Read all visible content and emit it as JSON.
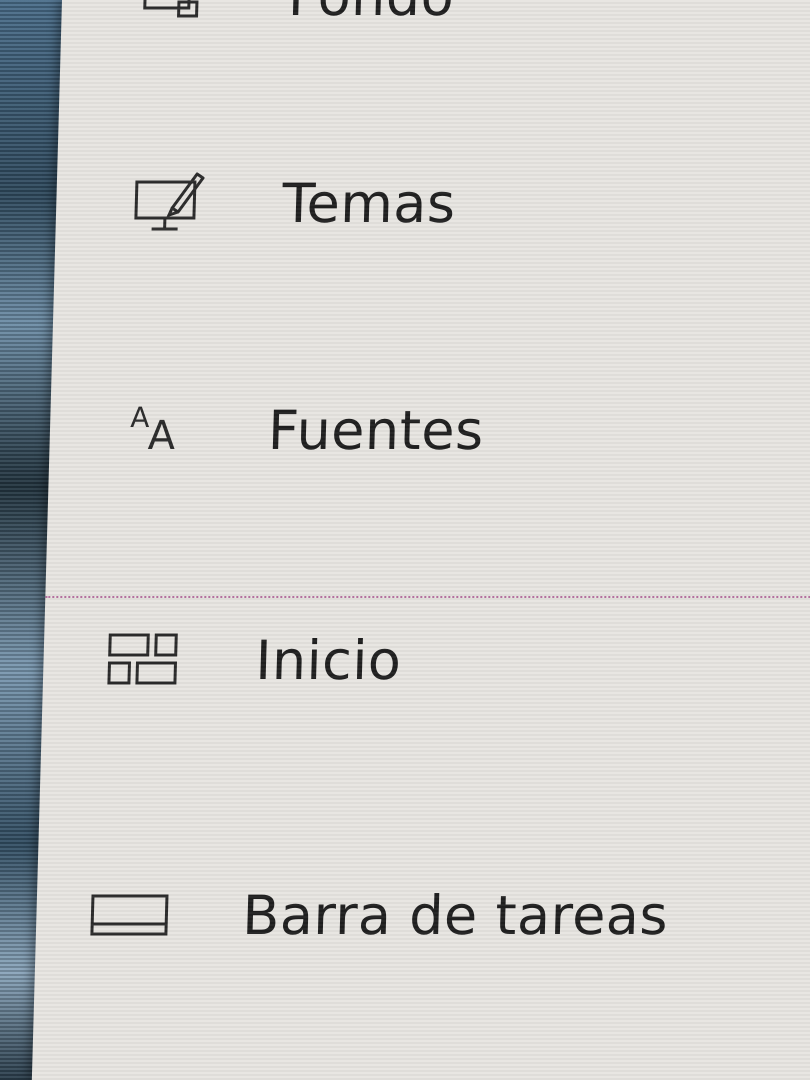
{
  "nav": {
    "items": [
      {
        "id": "partial",
        "label": "Fondo",
        "icon": "picture-icon"
      },
      {
        "id": "temas",
        "label": "Temas",
        "icon": "themes-icon"
      },
      {
        "id": "fuentes",
        "label": "Fuentes",
        "icon": "fonts-icon"
      },
      {
        "id": "inicio",
        "label": "Inicio",
        "icon": "start-icon"
      },
      {
        "id": "barra",
        "label": "Barra de tareas",
        "icon": "taskbar-icon"
      }
    ]
  },
  "icons": {
    "fonts_small": "A",
    "fonts_large": "A"
  },
  "colors": {
    "panel_background": "#e7e5e1",
    "text": "#1f1f1f",
    "icon_stroke": "#2a2a2a",
    "divider": "#b06a9a"
  }
}
